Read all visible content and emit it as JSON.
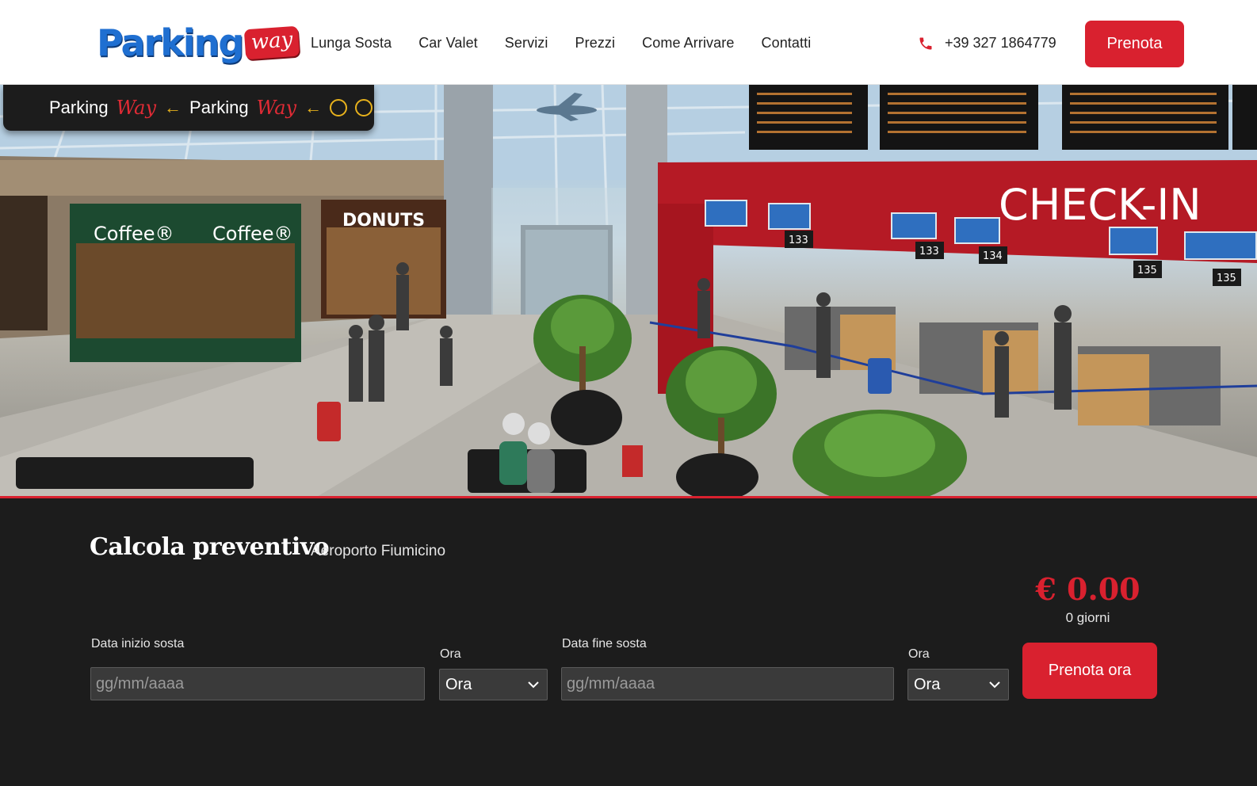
{
  "header": {
    "logo_text": "Parking",
    "logo_badge": "way",
    "nav": [
      {
        "label": "Lunga Sosta"
      },
      {
        "label": "Car Valet"
      },
      {
        "label": "Servizi"
      },
      {
        "label": "Prezzi"
      },
      {
        "label": "Come Arrivare"
      },
      {
        "label": "Contatti"
      }
    ],
    "phone": "+39 327 1864779",
    "cta": "Prenota"
  },
  "hero": {
    "sign": {
      "word1": "Parking",
      "way1": "Way",
      "word2": "Parking",
      "way2": "Way"
    },
    "shop1": "Coffee®",
    "shop2": "Coffee®",
    "shop3": "DONUTS",
    "checkin": "CHECK-IN",
    "counters": [
      "133",
      "133",
      "134",
      "135",
      "135"
    ]
  },
  "quote": {
    "title": "Calcola preventivo",
    "subtitle": "Aeroporto Fiumicino",
    "price": "€ 0.00",
    "days": "0 giorni",
    "start_label": "Data inizio sosta",
    "start_placeholder": "gg/mm/aaaa",
    "time1_label": "Ora",
    "time1_value": "Ora",
    "end_label": "Data fine sosta",
    "end_placeholder": "gg/mm/aaaa",
    "time2_label": "Ora",
    "time2_value": "Ora",
    "cta": "Prenota ora"
  },
  "colors": {
    "accent": "#d9212f",
    "brand_blue": "#1f6fd1",
    "dark": "#1c1c1c"
  }
}
